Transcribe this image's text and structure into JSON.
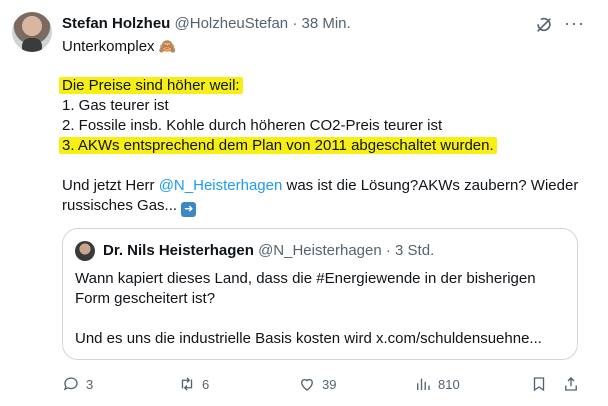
{
  "author": {
    "name": "Stefan Holzheu",
    "handle": "@HolzheuStefan",
    "separator": "·",
    "time": "38 Min."
  },
  "tweet": {
    "line1": "Unterkomplex",
    "line1_emoji": "🙈",
    "highlight_intro": "Die Preise sind höher weil:",
    "item1": "1. Gas teurer ist",
    "item2": "2. Fossile insb. Kohle durch höheren CO2-Preis teurer ist",
    "item3": "3. AKWs entsprechend dem Plan von 2011 abgeschaltet wurden.",
    "text_before_mention": "Und jetzt Herr ",
    "mention": "@N_Heisterhagen",
    "text_after_mention": " was ist die Lösung?AKWs zaubern? Wieder",
    "line_last": "russisches Gas...",
    "line_last_emoji": "➡️"
  },
  "quoted": {
    "name": "Dr. Nils Heisterhagen",
    "handle": "@N_Heisterhagen",
    "separator": "·",
    "time": "3 Std.",
    "line1": "Wann kapiert dieses Land, dass die #Energiewende in der bisherigen",
    "line2": "Form gescheitert ist?",
    "line3": "Und es uns die industrielle Basis kosten wird x.com/schuldensuehne..."
  },
  "actions": {
    "replies": "3",
    "reposts": "6",
    "likes": "39",
    "views": "810"
  },
  "colors": {
    "highlight": "#f7ef14",
    "link": "#1d9bf0",
    "muted": "#536471"
  }
}
